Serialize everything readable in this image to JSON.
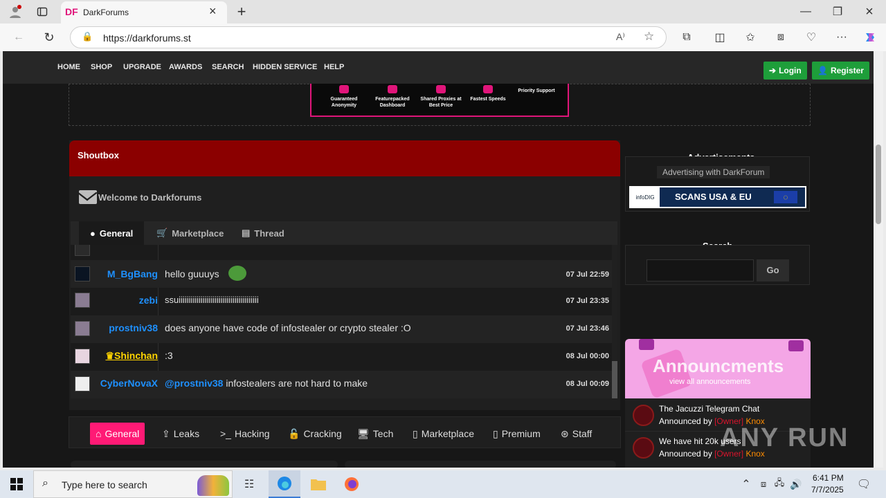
{
  "browser": {
    "tab_title": "DarkForums",
    "tab_favicon": "DF",
    "url": "https://darkforums.st"
  },
  "nav": {
    "links": [
      "HOME",
      "SHOP",
      "UPGRADE",
      "AWARDS",
      "SEARCH",
      "HIDDEN SERVICE",
      "HELP"
    ],
    "login": "Login",
    "register": "Register"
  },
  "top_banner": {
    "features": [
      "Guaranteed Anonymity",
      "Featurepacked Dashboard",
      "Shared Proxies at Best Price",
      "Fastest Speeds",
      "Priority Support"
    ]
  },
  "shoutbox": {
    "title": "Shoutbox",
    "welcome": "Welcome to Darkforums",
    "tabs": [
      "General",
      "Marketplace",
      "Thread"
    ],
    "messages": [
      {
        "user": "M_BgBang",
        "text": "hello guuuys",
        "time": "07 Jul 22:59"
      },
      {
        "user": "zebi",
        "text": "ssuiiiiiiiiiiiiiiiiiiiiiiiiiiiiiiiiiiiiiiii",
        "time": "07 Jul 23:35"
      },
      {
        "user": "prostniv38",
        "text": "does anyone have code of infostealer or crypto stealer :O",
        "time": "07 Jul 23:46"
      },
      {
        "user": "Shinchan",
        "text": ":3",
        "time": "08 Jul 00:00"
      },
      {
        "user": "CyberNovaX",
        "mention": "@prostniv38",
        "text": " infostealers are not hard to make",
        "time": "08 Jul 00:09"
      }
    ]
  },
  "forum_tabs": [
    "General",
    "Leaks",
    "Hacking",
    "Cracking",
    "Tech",
    "Marketplace",
    "Premium",
    "Staff"
  ],
  "sidebar": {
    "ads_title": "Advertisements",
    "ads_link": "Advertising with DarkForum",
    "ad_banner_brand": "infoDIG",
    "ad_banner_text": "SCANS USA & EU",
    "search_title": "Search",
    "search_button": "Go",
    "announcements_banner": "Announcments",
    "announcements_sub": "view all announcements",
    "announcements": [
      {
        "title": "The Jacuzzi Telegram Chat",
        "by_label": "Announced by",
        "role": "[Owner]",
        "author": "Knox"
      },
      {
        "title": "We have hit 20k users",
        "by_label": "Announced by",
        "role": "[Owner]",
        "author": "Knox"
      }
    ]
  },
  "watermark": "ANY RUN",
  "taskbar": {
    "search_placeholder": "Type here to search",
    "time": "6:41 PM",
    "date": "7/7/2025"
  },
  "colors": {
    "shout_header": "#8b0000",
    "accent_pink": "#ff1a75",
    "username_blue": "#1e90ff",
    "green_button": "#1e9e3a"
  }
}
